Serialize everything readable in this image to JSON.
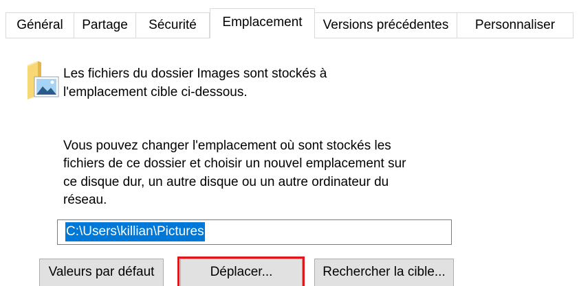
{
  "tabs": [
    {
      "label": "Général"
    },
    {
      "label": "Partage"
    },
    {
      "label": "Sécurité"
    },
    {
      "label": "Emplacement",
      "selected": true
    },
    {
      "label": "Versions précédentes"
    },
    {
      "label": "Personnaliser"
    }
  ],
  "location": {
    "icon": "folder-pictures-icon",
    "intro_lines": [
      "Les fichiers du dossier Images sont stockés à",
      "l'emplacement cible ci-dessous."
    ],
    "description_lines": [
      "Vous pouvez changer l'emplacement où sont stockés les",
      "fichiers de ce dossier et choisir un nouvel emplacement sur",
      "ce disque dur, un autre disque ou un autre ordinateur du",
      "réseau."
    ],
    "path_input": {
      "value": "C:\\Users\\killian\\Pictures",
      "text_selected": true
    },
    "buttons": {
      "restore_default": "Valeurs par défaut",
      "move": "Déplacer...",
      "find_target": "Rechercher la cible..."
    },
    "move_button_highlighted": true
  },
  "colors": {
    "selection_background": "#0078d7",
    "selection_text": "#ffffff",
    "highlight_border": "#e0161d",
    "button_background": "#e1e1e1",
    "button_border": "#adadad",
    "tab_border": "#d9d9d9",
    "input_border": "#7a7a7a"
  }
}
